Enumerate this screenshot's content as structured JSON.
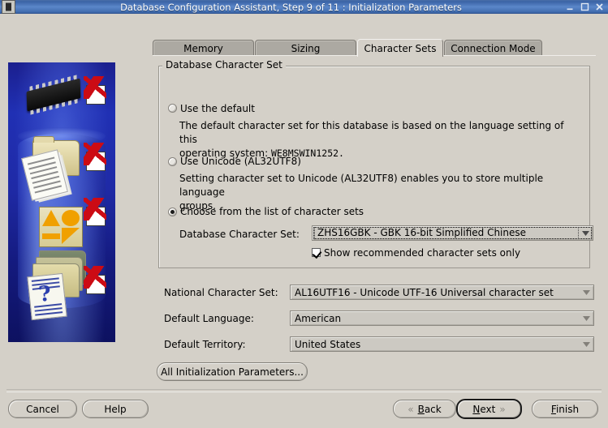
{
  "window": {
    "title": "Database Configuration Assistant, Step 9 of 11 : Initialization Parameters",
    "icon_name": "dbca-app-icon",
    "controls": {
      "minimize": "minimize-button",
      "maximize": "maximize-button",
      "close": "close-button"
    }
  },
  "banner": {
    "alt": "Oracle database configuration illustration with four completed checkmarks",
    "checks": 4
  },
  "tabs": [
    {
      "label": "Memory",
      "selected": false
    },
    {
      "label": "Sizing",
      "selected": false
    },
    {
      "label": "Character Sets",
      "selected": true
    },
    {
      "label": "Connection Mode",
      "selected": false
    }
  ],
  "group": {
    "title": "Database Character Set",
    "options": [
      {
        "label": "Use the default",
        "selected": false,
        "description_1": "The default character set for this database is based on the language setting of this",
        "description_2_prefix": "operating system: ",
        "description_2_value": "WE8MSWIN1252."
      },
      {
        "label": "Use Unicode (AL32UTF8)",
        "selected": false,
        "description_1": "Setting character set to Unicode (AL32UTF8) enables you to store multiple language",
        "description_2_prefix": "groups.",
        "description_2_value": ""
      },
      {
        "label": "Choose from the list of character sets",
        "selected": true
      }
    ],
    "db_charset": {
      "label": "Database Character Set:",
      "value": "ZHS16GBK - GBK 16-bit Simplified Chinese",
      "focused": true
    },
    "show_recommended": {
      "label": "Show recommended character sets only",
      "checked": true
    }
  },
  "fields": [
    {
      "label": "National Character Set:",
      "value": "AL16UTF16 - Unicode UTF-16 Universal character set"
    },
    {
      "label": "Default Language:",
      "value": "American"
    },
    {
      "label": "Default Territory:",
      "value": "United States"
    }
  ],
  "all_params_button": {
    "label": "All Initialization Parameters..."
  },
  "footer": {
    "cancel": "Cancel",
    "help": "Help",
    "back": {
      "prefix": "",
      "mnemonic": "B",
      "rest": "ack"
    },
    "next": {
      "prefix": "",
      "mnemonic": "N",
      "rest": "ext"
    },
    "finish": {
      "prefix": "",
      "mnemonic": "F",
      "rest": "inish"
    },
    "back_icon": "chevron-left-double-icon",
    "next_icon": "chevron-right-double-icon"
  },
  "colors": {
    "titlebar": "#3f6bae",
    "face": "#d4d0c8",
    "tab_unselected": "#aca9a2",
    "banner_blue": "#1f2aa6",
    "check_red": "#cc0b14"
  }
}
